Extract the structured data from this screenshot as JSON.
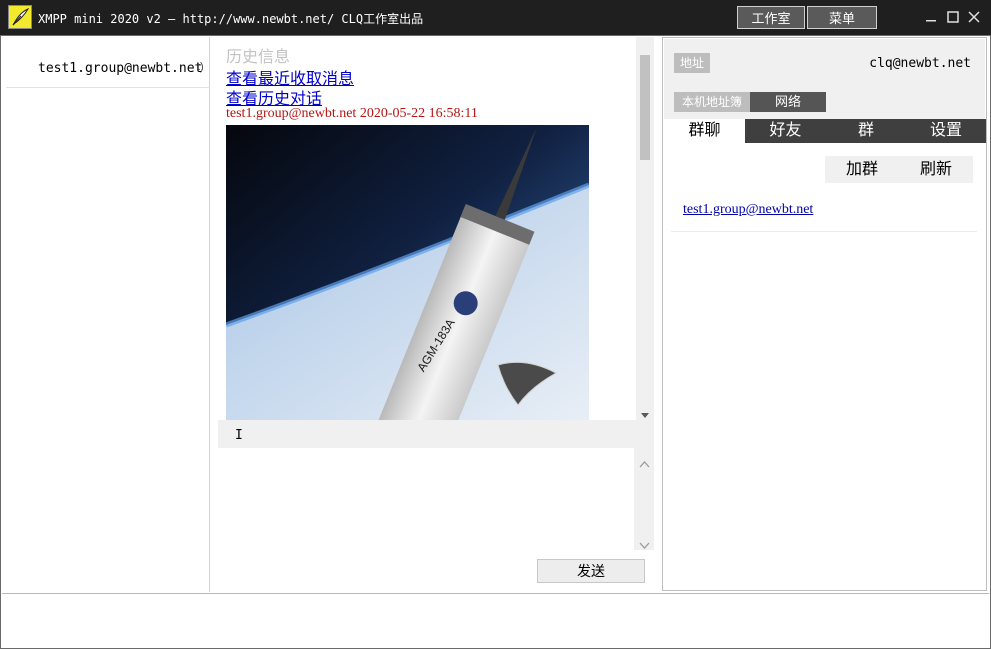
{
  "window": {
    "title": "XMPP mini 2020 v2 — http://www.newbt.net/  CLQ工作室出品",
    "buttons": {
      "studio": "工作室",
      "menu": "菜单"
    }
  },
  "contacts": {
    "items": [
      {
        "name": "test1.group@newbt.net",
        "trail": "t)"
      }
    ]
  },
  "chat": {
    "history_title": "历史信息",
    "link_recent": "查看最近收取消息",
    "link_history": "查看历史对话",
    "message": {
      "sender_time": "test1.group@newbt.net 2020-05-22 16:58:11",
      "image_text": "AGM-183A"
    },
    "input_caret": "I",
    "send_label": "发送"
  },
  "right": {
    "address_label": "地址",
    "account": "clq@newbt.net",
    "subtabs": [
      "本机地址簿",
      "网络"
    ],
    "tabs": [
      "群聊",
      "好友",
      "群",
      "设置"
    ],
    "active_tab": 0,
    "join_group": "加群",
    "refresh": "刷新",
    "groups": [
      "test1.group@newbt.net"
    ]
  },
  "colors": {
    "titlebar": "#1f1f1f",
    "tabbar": "#3f3f3f",
    "link": "#0000cc",
    "message_header": "#b51414"
  }
}
